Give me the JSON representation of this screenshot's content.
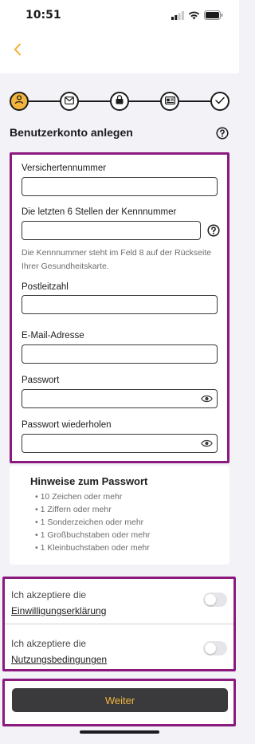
{
  "status": {
    "time": "10:51",
    "icons": [
      "signal-icon",
      "wifi-icon",
      "battery-icon"
    ]
  },
  "nav": {
    "back_icon": "chevron-left-icon"
  },
  "stepper": {
    "steps": [
      {
        "icon": "user-icon",
        "state": "active"
      },
      {
        "icon": "mail-icon",
        "state": "upcoming"
      },
      {
        "icon": "lock-icon",
        "state": "upcoming"
      },
      {
        "icon": "id-card-icon",
        "state": "upcoming"
      },
      {
        "icon": "check-icon",
        "state": "upcoming"
      }
    ]
  },
  "header": {
    "title": "Benutzerkonto anlegen",
    "help_icon": "help-circle-icon"
  },
  "form": {
    "fields": [
      {
        "label": "Versichertennummer",
        "value": "",
        "placeholder": ""
      },
      {
        "label": "Die letzten 6 Stellen der Kennnummer",
        "value": "",
        "placeholder": ""
      },
      {
        "label": "Postleitzahl",
        "value": "",
        "placeholder": ""
      },
      {
        "label": "E-Mail-Adresse",
        "value": "",
        "placeholder": ""
      },
      {
        "label": "Passwort",
        "value": "",
        "placeholder": ""
      },
      {
        "label": "Passwort wiederholen",
        "value": "",
        "placeholder": ""
      }
    ],
    "kennnummer_hint": "Die Kennnummer steht im Feld 8 auf der Rückseite Ihrer Gesundheitskarte."
  },
  "password_hints": {
    "title": "Hinweise zum Passwort",
    "items": [
      "• 10 Zeichen oder mehr",
      "• 1 Ziffern oder mehr",
      "• 1 Sonderzeichen oder mehr",
      "• 1 Großbuchstaben oder mehr",
      "• 1 Kleinbuchstaben oder mehr"
    ]
  },
  "consents": [
    {
      "prefix": "Ich akzeptiere die",
      "link": "Einwilligungserklärung",
      "checked": false
    },
    {
      "prefix": "Ich akzeptiere die",
      "link": "Nutzungsbedingungen",
      "checked": false
    }
  ],
  "footer": {
    "weiter_label": "Weiter"
  },
  "colors": {
    "accent": "#f2b43b",
    "highlight_border": "#8b1a7e",
    "button_bg": "#3a3a3c",
    "background": "#f2f2f7"
  }
}
